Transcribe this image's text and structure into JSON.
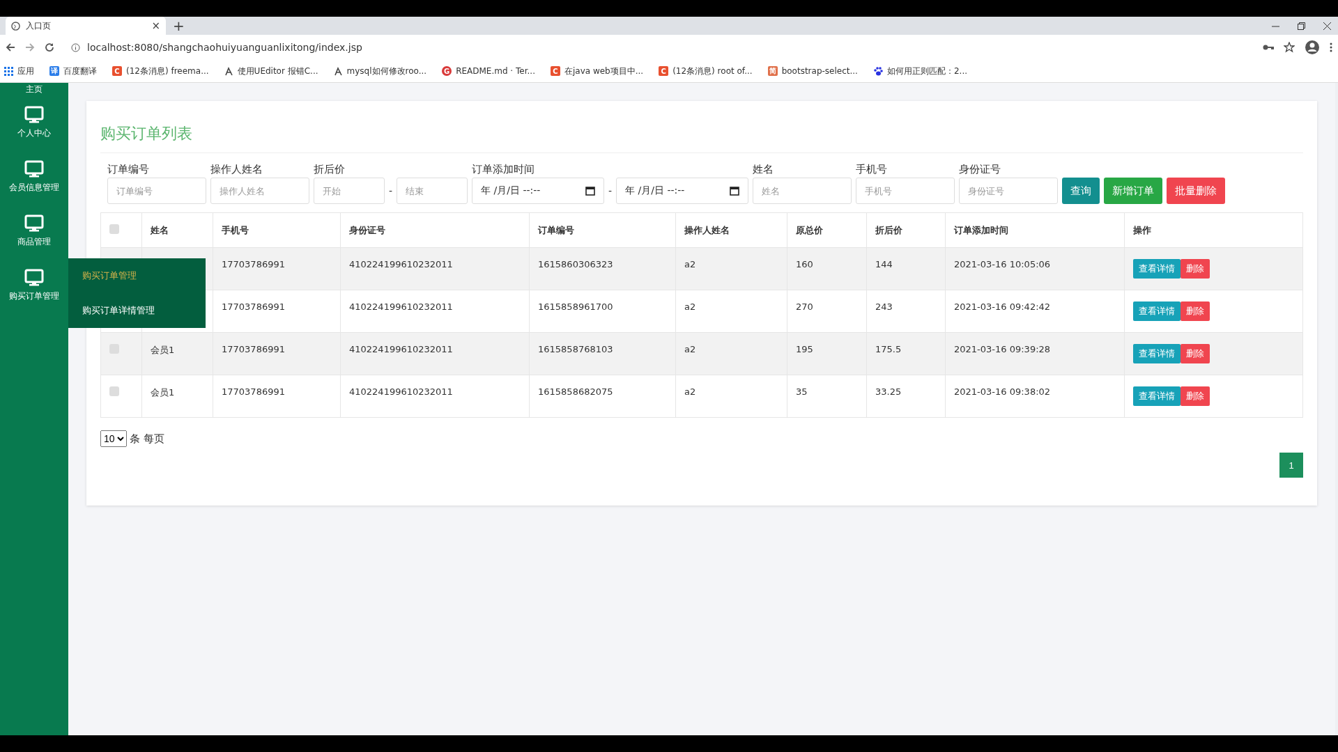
{
  "browser": {
    "tab": {
      "title": "入口页",
      "close": "×"
    },
    "new_tab": "+",
    "address": "localhost:8080/shangchaohuiyuanguanlixitong/index.jsp",
    "bookmarks": [
      {
        "kind": "apps",
        "label": "应用"
      },
      {
        "kind": "badge",
        "color": "#2b7de9",
        "glyph": "译",
        "label": "百度翻译"
      },
      {
        "kind": "badge",
        "color": "#e8502f",
        "glyph": "C",
        "label": "(12条消息) freema..."
      },
      {
        "kind": "glyph",
        "label": "使用UEditor 报错C..."
      },
      {
        "kind": "glyph",
        "label": "mysql如何修改roo..."
      },
      {
        "kind": "circle",
        "color": "#d93a3a",
        "glyph": "G",
        "label": "README.md · Ter..."
      },
      {
        "kind": "badge",
        "color": "#e8502f",
        "glyph": "C",
        "label": "在java web项目中..."
      },
      {
        "kind": "badge",
        "color": "#e8502f",
        "glyph": "C",
        "label": "(12条消息) root of..."
      },
      {
        "kind": "badge",
        "color": "#e0704a",
        "glyph": "简",
        "label": "bootstrap-select..."
      },
      {
        "kind": "paw",
        "label": "如何用正则匹配：2..."
      }
    ]
  },
  "sidebar": {
    "items": [
      {
        "label": "主页"
      },
      {
        "label": "个人中心"
      },
      {
        "label": "会员信息管理"
      },
      {
        "label": "商品管理"
      },
      {
        "label": "购买订单管理",
        "children": [
          {
            "label": "购买订单管理",
            "selected": true
          },
          {
            "label": "购买订单详情管理",
            "selected": false
          }
        ]
      }
    ]
  },
  "page": {
    "title": "购买订单列表",
    "filters": [
      {
        "kind": "text",
        "label": "订单编号",
        "placeholder": "订单编号"
      },
      {
        "kind": "text",
        "label": "操作人姓名",
        "placeholder": "操作人姓名"
      },
      {
        "kind": "range",
        "label": "折后价",
        "from": {
          "placeholder": "开始"
        },
        "separator": "-",
        "to": {
          "placeholder": "结束"
        }
      },
      {
        "kind": "date-range",
        "label": "订单添加时间",
        "from": {
          "placeholder": "年 /月/日 --:--"
        },
        "separator": "-",
        "to": {
          "placeholder": "年 /月/日 --:--"
        }
      },
      {
        "kind": "text",
        "label": "姓名",
        "placeholder": "姓名"
      },
      {
        "kind": "text",
        "label": "手机号",
        "placeholder": "手机号"
      },
      {
        "kind": "text",
        "label": "身份证号",
        "placeholder": "身份证号"
      }
    ],
    "buttons": [
      {
        "kind": "info",
        "label": "查询"
      },
      {
        "kind": "success",
        "label": "新增订单"
      },
      {
        "kind": "danger",
        "label": "批量删除"
      }
    ],
    "table": {
      "header_checked": false,
      "columns": [
        "姓名",
        "手机号",
        "身份证号",
        "订单编号",
        "操作人姓名",
        "原总价",
        "折后价",
        "订单添加时间",
        "操作"
      ],
      "rows": [
        {
          "cells": [
            "",
            "17703786991",
            "410224199610232011",
            "1615860306323",
            "a2",
            "160",
            "144",
            "2021-03-16 10:05:06"
          ],
          "actions": [
            "查看详情",
            "删除"
          ]
        },
        {
          "cells": [
            "",
            "17703786991",
            "410224199610232011",
            "1615858961700",
            "a2",
            "270",
            "243",
            "2021-03-16 09:42:42"
          ],
          "actions": [
            "查看详情",
            "删除"
          ]
        },
        {
          "checked": false,
          "cells": [
            "会员1",
            "17703786991",
            "410224199610232011",
            "1615858768103",
            "a2",
            "195",
            "175.5",
            "2021-03-16 09:39:28"
          ],
          "actions": [
            "查看详情",
            "删除"
          ]
        },
        {
          "checked": false,
          "cells": [
            "会员1",
            "17703786991",
            "410224199610232011",
            "1615858682075",
            "a2",
            "35",
            "33.25",
            "2021-03-16 09:38:02"
          ],
          "actions": [
            "查看详情",
            "删除"
          ]
        }
      ]
    },
    "page_size": {
      "value": "10",
      "suffix": "条 每页"
    },
    "pagination": [
      {
        "label": "1",
        "selected": true
      }
    ]
  }
}
